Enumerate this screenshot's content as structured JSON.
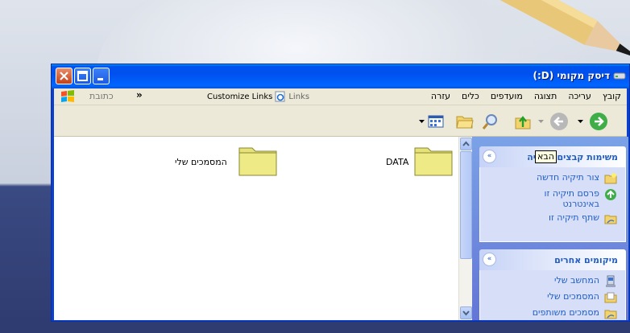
{
  "window": {
    "title": "דיסק מקומי (D:)"
  },
  "menu": {
    "items": [
      "קובץ",
      "עריכה",
      "תצוגה",
      "מועדפים",
      "כלים",
      "עזרה"
    ]
  },
  "links_bar": {
    "links_label": "Links",
    "customize_label": "Customize Links",
    "chevron": "»"
  },
  "address_bar": {
    "label": "כתובת"
  },
  "folders": [
    {
      "name": "DATA"
    },
    {
      "name": "המסמכים שלי"
    }
  ],
  "task_pane": {
    "file_tasks": {
      "title": "משימות קבצים ותיקיה",
      "chevron": "«",
      "items": [
        "צור תיקיה חדשה",
        "פרסם תיקיה זו באינטרנט",
        "שתף תיקיה זו"
      ]
    },
    "other_places": {
      "title": "מיקומים אחרים",
      "chevron": "«",
      "items": [
        "המחשב שלי",
        "המסמכים שלי",
        "מסמכים משותפים"
      ]
    }
  },
  "tooltip": {
    "text": "הבא"
  }
}
